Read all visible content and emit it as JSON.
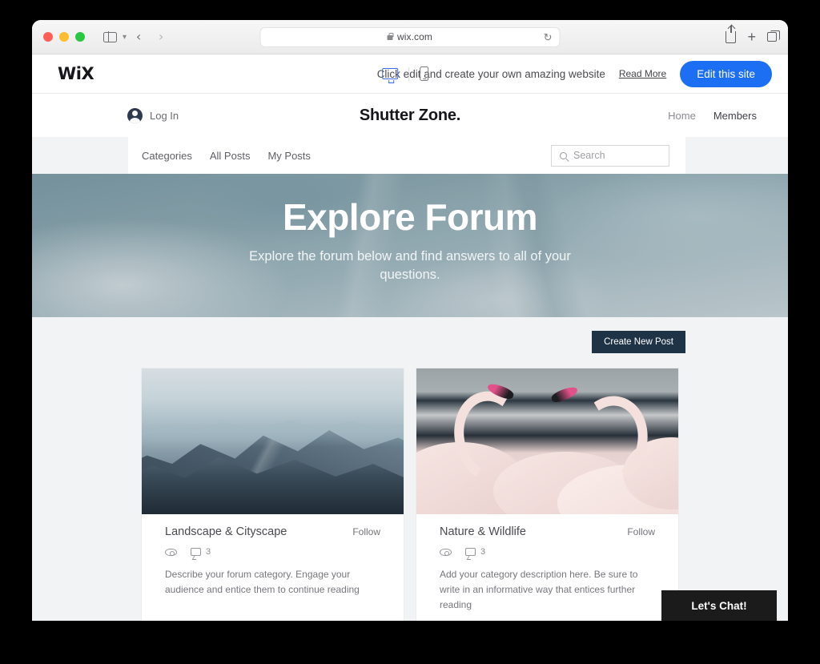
{
  "browser": {
    "url": "wix.com",
    "lock_icon": "lock-icon",
    "reload_icon": "reload-icon",
    "back_icon": "chevron-left-icon",
    "forward_icon": "chevron-right-icon",
    "sidebar_icon": "sidebar-toggle-icon",
    "sidebar_chevron": "chevron-down-icon",
    "share_icon": "share-icon",
    "new_tab_icon": "plus-icon",
    "tabs_icon": "tabs-overview-icon"
  },
  "wix_bar": {
    "logo": "WiX",
    "desktop_icon": "desktop-view-icon",
    "mobile_icon": "mobile-view-icon",
    "promo_text": "Click edit and create your own amazing website",
    "read_more": "Read More",
    "edit_button": "Edit this site",
    "accent_color": "#1c6ef2"
  },
  "site_header": {
    "login_label": "Log In",
    "avatar_icon": "user-avatar-icon",
    "title": "Shutter Zone.",
    "nav": [
      {
        "label": "Home"
      },
      {
        "label": "Members"
      }
    ]
  },
  "forum_bar": {
    "tabs": [
      {
        "label": "Categories"
      },
      {
        "label": "All Posts"
      },
      {
        "label": "My Posts"
      }
    ],
    "search_placeholder": "Search",
    "search_value": "",
    "search_icon": "search-icon"
  },
  "hero": {
    "title": "Explore Forum",
    "subtitle": "Explore the forum below and find answers to all of your questions."
  },
  "forum": {
    "create_post_button": "Create New Post",
    "create_post_color": "#1f3347",
    "cards": [
      {
        "title": "Landscape & Cityscape",
        "follow_label": "Follow",
        "views_icon": "eye-icon",
        "comments_icon": "comment-bubble-icon",
        "comments_count": "3",
        "description": "Describe your forum category. Engage your audience and entice them to continue reading",
        "image_alt": "mountain-range-photo"
      },
      {
        "title": "Nature & Wildlife",
        "follow_label": "Follow",
        "views_icon": "eye-icon",
        "comments_icon": "comment-bubble-icon",
        "comments_count": "3",
        "description": "Add your category description here. Be sure to write in an informative way that entices further reading",
        "image_alt": "flamingos-photo"
      }
    ]
  },
  "chat_widget": {
    "label": "Let's Chat!",
    "color": "#1b1b1b"
  }
}
